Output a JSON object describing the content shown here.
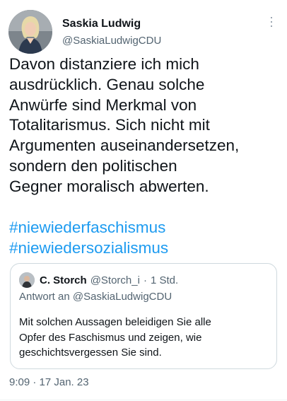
{
  "author": {
    "display_name": "Saskia Ludwig",
    "handle": "@SaskiaLudwigCDU"
  },
  "tweet": {
    "text": "Davon distanziere ich mich\nausdrücklich. Genau solche\nAnwürfe sind Merkmal von\nTotalitarismus. Sich nicht mit\nArgumenten auseinandersetzen,\nsondern den politischen\nGegner moralisch abwerten.",
    "hashtags": [
      "#niewiederfaschismus",
      "#niewiedersozialismus"
    ],
    "timestamp": "9:09 · 17 Jan. 23"
  },
  "quoted_tweet": {
    "display_name": "C. Storch",
    "handle": "@Storch_i",
    "separator": "·",
    "age": "1 Std.",
    "reply_to": "Antwort an @SaskiaLudwigCDU",
    "text": "Mit solchen Aussagen beleidigen Sie alle\nOpfer des Faschismus und zeigen, wie\ngeschichtsvergessen Sie sind."
  },
  "icons": {
    "more": "more-vertical-icon"
  },
  "colors": {
    "text": "#0f1419",
    "secondary": "#536471",
    "link": "#1d9bf0",
    "border": "#cfd9de"
  }
}
